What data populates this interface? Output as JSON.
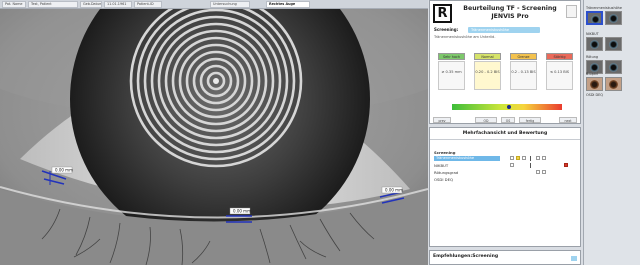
{
  "tabs": [
    {
      "label": "Pat. Name"
    },
    {
      "label": "Test, Patient"
    },
    {
      "label": "Geb.Datum"
    },
    {
      "label": "11.01.1961"
    },
    {
      "label": "Patient-ID"
    },
    {
      "label": "Untersuchung"
    },
    {
      "label": "Rechtes Auge"
    }
  ],
  "eye_panel": {
    "measurements": [
      {
        "label": "0.00 mm"
      },
      {
        "label": "0.00 mm"
      },
      {
        "label": "0.00 mm"
      }
    ]
  },
  "report": {
    "logo_letter": "R",
    "title_line1": "Beurteilung TF - Screening",
    "title_line2": "JENVIS Pro",
    "screening_label": "Screening:",
    "screening_value": "Tränenmeniskushöhe",
    "screening_note": "Tränenmeniskushöhe am Unterlid.",
    "categories": [
      {
        "label": "Sehr hoch",
        "color": "#7dc86b",
        "value": "≥ 0.35 mm"
      },
      {
        "label": "Normal",
        "color": "#d6e36b",
        "value": "0.20 - 0.2 BIS"
      },
      {
        "label": "Grenze reduziert",
        "color": "#f3c24e",
        "value": "0.2 - 0.13 BIS"
      },
      {
        "label": "Stärkig",
        "color": "#ea6a5a",
        "value": "≤ 0.13 BIS"
      }
    ],
    "gauge_value": 0.52,
    "buttons": [
      "prev",
      "OD",
      "OS",
      "fertig",
      "next"
    ]
  },
  "panel2": {
    "title": "Mehrfachansicht und Bewertung",
    "section": "Screening",
    "selected": "Tränenmeniskushöhe",
    "rows": [
      "NIKBUT",
      "Rötungsgrad",
      "OSDI DEQ"
    ]
  },
  "panel3": {
    "title": "Empfehlungen:Screening"
  },
  "thumbs": {
    "groups": [
      {
        "label": "Tränenmeniskushöhe"
      },
      {
        "label": "NIKBUT"
      },
      {
        "label": "Rötung"
      },
      {
        "label": "B-Lipid"
      },
      {
        "label": "OSDI DEQ"
      }
    ]
  },
  "colors": {
    "accent": "#2c4fcc",
    "measure_line": "#2233bb",
    "selection_blue": "#6fb8e8"
  }
}
